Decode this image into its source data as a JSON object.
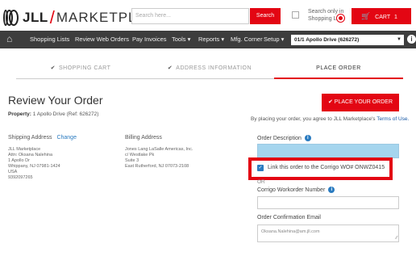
{
  "header": {
    "logo_brand": "JLL",
    "logo_product": "MARKETPLACE",
    "search": {
      "placeholder": "Search here...",
      "button": "Search"
    },
    "shopping_only": {
      "label": "Search only in Shopping Lists"
    },
    "cart": {
      "label": "CART",
      "count": "1 items"
    }
  },
  "nav": {
    "items": [
      "Shopping Lists",
      "Review Web Orders",
      "Pay Invoices",
      "Tools ▾",
      "Reports ▾",
      "Mfg. Corner",
      "Setup ▾"
    ],
    "location": "01/1 Apollo Drive (626272)"
  },
  "steps": [
    {
      "label": "SHOPPING CART",
      "done": true
    },
    {
      "label": "ADDRESS INFORMATION",
      "done": true
    },
    {
      "label": "PLACE ORDER",
      "done": false
    }
  ],
  "order": {
    "title": "Review Your Order",
    "property_label": "Property:",
    "property_value": "1 Apollo Drive (Ref: 626272)",
    "place_button": "PLACE YOUR ORDER",
    "agree_text": "By placing your order, you agree to JLL Marketplace's",
    "terms_link": "Terms of Use."
  },
  "shipping": {
    "heading": "Shipping Address",
    "change": "Change",
    "lines": [
      "JLL Marketplace",
      "Attn: Oksana Nalehina",
      "1 Apollo Dr",
      "Whippany, NJ 07981-1424",
      "USA",
      "9392097265"
    ]
  },
  "billing": {
    "heading": "Billing Address",
    "lines": [
      "Jones Lang LaSalle Americas, Inc.",
      "c/ Westlake Pk",
      "Suite 3",
      "East Rutherford, NJ 07073-2108"
    ]
  },
  "form": {
    "description_label": "Order Description",
    "description_value": "",
    "link_label": "Link this order to the Corrigo WO# ONWZ0415",
    "link_checked": true,
    "or_label": "OR",
    "workorder_label": "Corrigo Workorder Number",
    "workorder_value": "",
    "email_label": "Order Confirmation Email",
    "email_value": "Oksana.Nalehina@am.jll.com"
  },
  "colors": {
    "brand_red": "#e30613",
    "nav_bg": "#3d3d3d",
    "link_blue": "#2a7bc0",
    "input_highlight": "#a5d5ee"
  }
}
